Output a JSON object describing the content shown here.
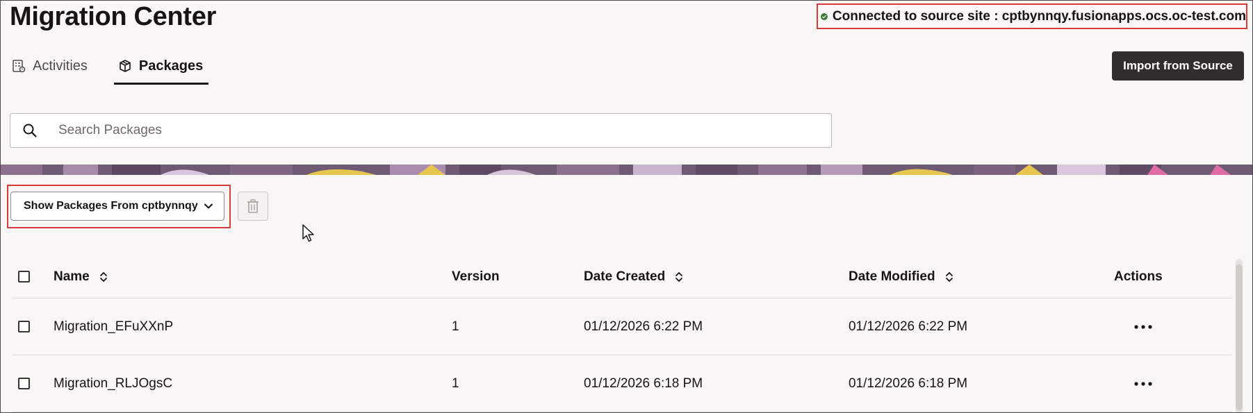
{
  "header": {
    "title": "Migration Center",
    "connection_status": "Connected to source site : cptbynnqy.fusionapps.ocs.oc-test.com",
    "status_color": "#3d7a3a"
  },
  "tabs": [
    {
      "label": "Activities",
      "icon": "activities-icon",
      "active": false
    },
    {
      "label": "Packages",
      "icon": "package-icon",
      "active": true
    }
  ],
  "toolbar": {
    "import_label": "Import from Source",
    "show_packages_label": "Show Packages From cptbynnqy"
  },
  "search": {
    "placeholder": "Search Packages",
    "value": ""
  },
  "table": {
    "columns": {
      "name": "Name",
      "version": "Version",
      "date_created": "Date Created",
      "date_modified": "Date Modified",
      "actions": "Actions"
    },
    "rows": [
      {
        "name": "Migration_EFuXXnP",
        "version": "1",
        "date_created": "01/12/2026 6:22 PM",
        "date_modified": "01/12/2026 6:22 PM"
      },
      {
        "name": "Migration_RLJOgsC",
        "version": "1",
        "date_created": "01/12/2026 6:18 PM",
        "date_modified": "01/12/2026 6:18 PM"
      }
    ]
  },
  "colors": {
    "primary_button": "#312d2a",
    "highlight_border": "#d93a3a",
    "background": "#f8f7f5"
  }
}
